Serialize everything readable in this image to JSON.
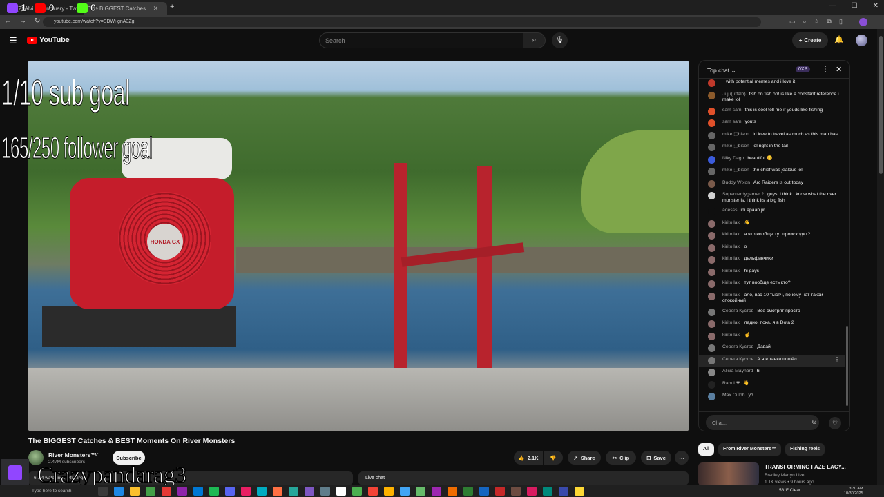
{
  "browser": {
    "tabs": [
      {
        "label": "(2) Alvi... Sanctuary - Twitch"
      },
      {
        "label": "The BIGGEST Catches..."
      }
    ],
    "url": "youtube.com/watch?v=SDWj-gnA3Zg"
  },
  "stream_counter": {
    "twitch": "1",
    "youtube": "0",
    "kick": "0"
  },
  "youtube_header": {
    "logo_text": "YouTube",
    "search_placeholder": "Search",
    "create_label": "Create"
  },
  "video": {
    "overlay_sub_goal": "1/10 sub goal",
    "overlay_follower_goal": "165/250 follower goal",
    "engine_badge": "HONDA GX",
    "title": "The BIGGEST Catches & BEST Moments On River Monsters",
    "channel_name": "River Monsters™",
    "subscribers": "2.47M subscribers",
    "subscribe_label": "Subscribe",
    "likes": "2.1K",
    "share_label": "Share",
    "clip_label": "Clip",
    "save_label": "Save",
    "description_snippet": "6,.74 watching... #fishing",
    "live_chat_label": "Live chat"
  },
  "chat": {
    "title": "Top chat",
    "xp_badge": "0XP",
    "input_placeholder": "Chat...",
    "messages": [
      {
        "name": "",
        "text": "with potential memes and i love it",
        "color": "#c0392b"
      },
      {
        "name": "Juju(uftalo)",
        "text": "fish on fish on! is like a constant reference i make lol",
        "color": "#8b5a2b"
      },
      {
        "name": "sam sam",
        "text": "this is cool tell me if youds like fishing",
        "color": "#e0502a"
      },
      {
        "name": "sam sam",
        "text": "youts",
        "color": "#e0502a"
      },
      {
        "name": "mike ⬚bison",
        "text": "Id love to travel as much as this man has",
        "color": "#666666"
      },
      {
        "name": "mike ⬚bison",
        "text": "lol right in the tail",
        "color": "#666666"
      },
      {
        "name": "Niky Dago",
        "text": "beautiful 😊",
        "color": "#3b5bdb"
      },
      {
        "name": "mike ⬚bison",
        "text": "the chief was jealous lol",
        "color": "#666666"
      },
      {
        "name": "Buddy Wixon",
        "text": "Arc Raiders is out today",
        "color": "#7a5a4a"
      },
      {
        "name": "Supernerdygamer 2",
        "text": "guys, i think i know what the river monster is, i think its a big fish",
        "color": "#d0d0d0"
      },
      {
        "name": "adesss",
        "text": "ini apaan jir",
        "color": "#0f0f0f"
      },
      {
        "name": "kirito laki",
        "text": "👋",
        "color": "#8a6a6a"
      },
      {
        "name": "kirito laki",
        "text": "а что вообще тут происходит?",
        "color": "#8a6a6a"
      },
      {
        "name": "kirito laki",
        "text": "о",
        "color": "#8a6a6a"
      },
      {
        "name": "kirito laki",
        "text": "дельфинчики",
        "color": "#8a6a6a"
      },
      {
        "name": "kirito laki",
        "text": "hi gays",
        "color": "#8a6a6a"
      },
      {
        "name": "kirito laki",
        "text": "тут вообще есть кто?",
        "color": "#8a6a6a"
      },
      {
        "name": "kirito laki",
        "text": "ало, вас 10 тысяч, почему чат такой спокойный",
        "color": "#8a6a6a"
      },
      {
        "name": "Серега Кустов",
        "text": "Все смотрят просто",
        "color": "#777777"
      },
      {
        "name": "kirito laki",
        "text": "ладно, пока, я в Dota 2",
        "color": "#8a6a6a"
      },
      {
        "name": "kirito laki",
        "text": "✌",
        "color": "#8a6a6a"
      },
      {
        "name": "Серега Кустов",
        "text": "Давай",
        "color": "#777777"
      },
      {
        "name": "Серега Кустов",
        "text": "А я в танки пошёл",
        "color": "#777777"
      },
      {
        "name": "Alicia Maynard",
        "text": "hi",
        "color": "#888888"
      },
      {
        "name": "Rahul ❤",
        "text": "👋",
        "color": "#222222"
      },
      {
        "name": "Max Culph",
        "text": "yo",
        "color": "#5a7fa0"
      }
    ]
  },
  "related": {
    "chips": [
      "All",
      "From River Monsters™",
      "Fishing reels"
    ],
    "rec_title": "TRANSFORMING FAZE LACY...",
    "rec_channel": "Bradley Martyn Live",
    "rec_meta": "1.1K views • 9 hours ago"
  },
  "streamer": {
    "name": "Crazypandarag3"
  },
  "taskbar": {
    "search_placeholder": "Type here to search",
    "weather": "58°F  Clear",
    "time": "3:30 AM",
    "date": "10/30/2025"
  }
}
